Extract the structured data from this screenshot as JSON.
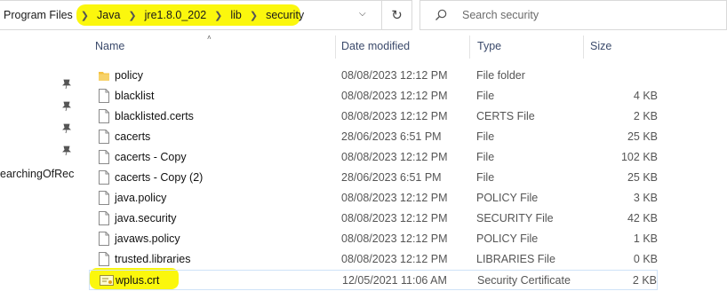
{
  "breadcrumb": [
    "Program Files",
    "Java",
    "jre1.8.0_202",
    "lib",
    "security"
  ],
  "search": {
    "placeholder": "Search security"
  },
  "nav": {
    "partial_item": "earchingOfRec"
  },
  "columns": {
    "name": "Name",
    "date": "Date modified",
    "type": "Type",
    "size": "Size"
  },
  "files": [
    {
      "name": "policy",
      "date": "08/08/2023 12:12 PM",
      "type": "File folder",
      "size": "",
      "icon": "folder-icon"
    },
    {
      "name": "blacklist",
      "date": "08/08/2023 12:12 PM",
      "type": "File",
      "size": "4 KB",
      "icon": "file-icon"
    },
    {
      "name": "blacklisted.certs",
      "date": "08/08/2023 12:12 PM",
      "type": "CERTS File",
      "size": "2 KB",
      "icon": "file-icon"
    },
    {
      "name": "cacerts",
      "date": "28/06/2023 6:51 PM",
      "type": "File",
      "size": "25 KB",
      "icon": "file-icon"
    },
    {
      "name": "cacerts - Copy",
      "date": "08/08/2023 12:12 PM",
      "type": "File",
      "size": "102 KB",
      "icon": "file-icon"
    },
    {
      "name": "cacerts - Copy (2)",
      "date": "28/06/2023 6:51 PM",
      "type": "File",
      "size": "25 KB",
      "icon": "file-icon"
    },
    {
      "name": "java.policy",
      "date": "08/08/2023 12:12 PM",
      "type": "POLICY File",
      "size": "3 KB",
      "icon": "file-icon"
    },
    {
      "name": "java.security",
      "date": "08/08/2023 12:12 PM",
      "type": "SECURITY File",
      "size": "42 KB",
      "icon": "file-icon"
    },
    {
      "name": "javaws.policy",
      "date": "08/08/2023 12:12 PM",
      "type": "POLICY File",
      "size": "1 KB",
      "icon": "file-icon"
    },
    {
      "name": "trusted.libraries",
      "date": "08/08/2023 12:12 PM",
      "type": "LIBRARIES File",
      "size": "0 KB",
      "icon": "file-icon"
    },
    {
      "name": "wplus.crt",
      "date": "12/05/2021 11:06 AM",
      "type": "Security Certificate",
      "size": "2 KB",
      "icon": "certificate-icon"
    }
  ],
  "colors": {
    "highlight": "#fbf700",
    "header_text": "#3b4a6b",
    "selection_border": "#cfe3f8"
  }
}
